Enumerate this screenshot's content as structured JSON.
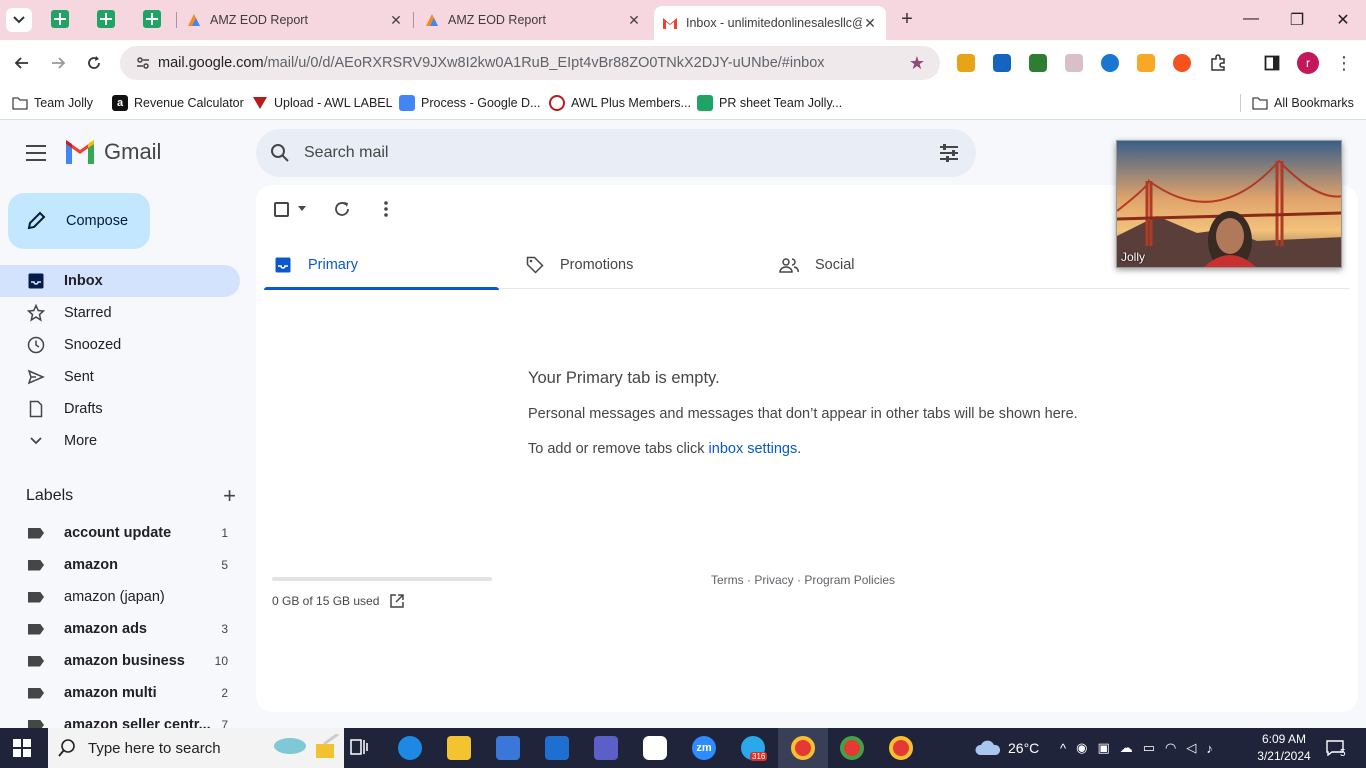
{
  "browser": {
    "tabs": [
      {
        "title": "AMZ EOD Report"
      },
      {
        "title": "AMZ EOD Report"
      },
      {
        "title": "Inbox - unlimitedonlinesalesllc@gmail.com"
      }
    ],
    "url_host": "mail.google.com",
    "url_path": "/mail/u/0/d/AEoRXRSRV9JXw8I2kw0A1RuB_EIpt4vBr88ZO0TNkX2DJY-uUNbe/#inbox",
    "profile_initial": "r",
    "bookmarks": [
      {
        "label": "Team Jolly"
      },
      {
        "label": "Revenue Calculator"
      },
      {
        "label": "Upload - AWL LABEL"
      },
      {
        "label": "Process - Google D..."
      },
      {
        "label": "AWL Plus Members..."
      },
      {
        "label": "PR sheet Team Jolly..."
      }
    ],
    "all_bookmarks": "All Bookmarks"
  },
  "gmail": {
    "product_name": "Gmail",
    "search_placeholder": "Search mail",
    "compose_label": "Compose",
    "nav": [
      {
        "label": "Inbox",
        "icon": "inbox-icon"
      },
      {
        "label": "Starred",
        "icon": "star-icon"
      },
      {
        "label": "Snoozed",
        "icon": "clock-icon"
      },
      {
        "label": "Sent",
        "icon": "send-icon"
      },
      {
        "label": "Drafts",
        "icon": "draft-icon"
      },
      {
        "label": "More",
        "icon": "chevron-down-icon"
      }
    ],
    "labels_heading": "Labels",
    "labels": [
      {
        "name": "account update",
        "count": "1"
      },
      {
        "name": "amazon",
        "count": "5"
      },
      {
        "name": "amazon (japan)",
        "count": ""
      },
      {
        "name": "amazon ads",
        "count": "3"
      },
      {
        "name": "amazon business",
        "count": "10"
      },
      {
        "name": "amazon multi",
        "count": "2"
      },
      {
        "name": "amazon seller centr...",
        "count": "7"
      }
    ],
    "inbox_tabs": [
      {
        "label": "Primary"
      },
      {
        "label": "Promotions"
      },
      {
        "label": "Social"
      }
    ],
    "empty_title": "Your Primary tab is empty.",
    "empty_desc": "Personal messages and messages that don’t appear in other tabs will be shown here.",
    "empty_settings_prefix": "To add or remove tabs click ",
    "empty_settings_link": "inbox settings",
    "empty_settings_suffix": ".",
    "storage_text": "0 GB of 15 GB used",
    "storage_used_fraction": 0.0,
    "footer": {
      "terms": "Terms",
      "privacy": "Privacy",
      "policies": "Program Policies",
      "sep": " · "
    }
  },
  "video": {
    "participant": "Jolly"
  },
  "taskbar": {
    "search_placeholder": "Type here to search",
    "weather": "26°C",
    "time": "6:09 AM",
    "date": "3/21/2024",
    "telegram_badge": "316",
    "notification_count": "5"
  },
  "colors": {
    "accent": "#0b57d0",
    "compose_bg": "#c2e7ff",
    "active_nav": "#d3e3fd",
    "tabstrip": "#f6d7df"
  }
}
